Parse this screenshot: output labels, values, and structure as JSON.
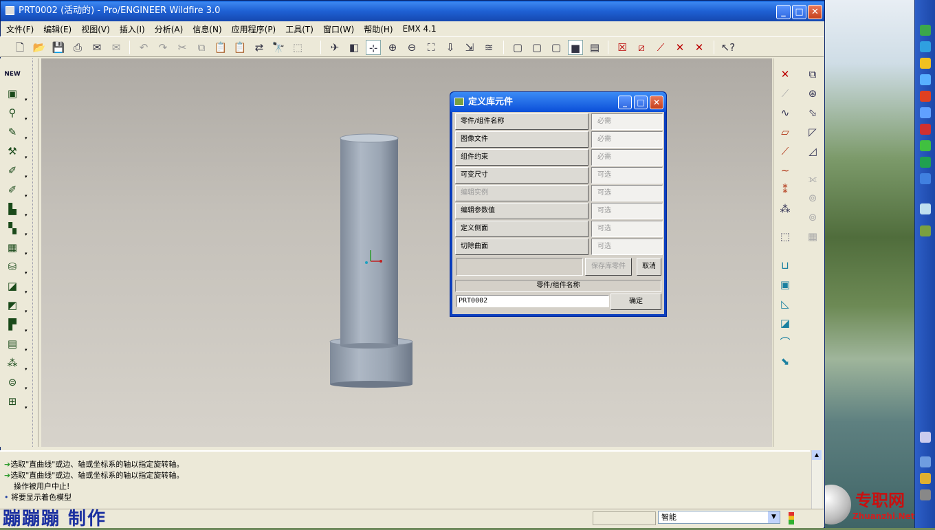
{
  "window": {
    "title": "PRT0002 (活动的) - Pro/ENGINEER Wildfire 3.0"
  },
  "menu": [
    "文件(F)",
    "编辑(E)",
    "视图(V)",
    "插入(I)",
    "分析(A)",
    "信息(N)",
    "应用程序(P)",
    "工具(T)",
    "窗口(W)",
    "帮助(H)",
    "EMX 4.1"
  ],
  "left_toolbar": {
    "new_label": "NEW"
  },
  "dialog": {
    "title": "定义库元件",
    "rows": [
      {
        "label": "零件/组件名称",
        "value": "必需",
        "enabled": true
      },
      {
        "label": "图像文件",
        "value": "必需",
        "enabled": true
      },
      {
        "label": "组件约束",
        "value": "必需",
        "enabled": true
      },
      {
        "label": "可变尺寸",
        "value": "可选",
        "enabled": true
      },
      {
        "label": "编辑实例",
        "value": "可选",
        "enabled": false
      },
      {
        "label": "编辑参数值",
        "value": "可选",
        "enabled": true
      },
      {
        "label": "定义侧面",
        "value": "可选",
        "enabled": true
      },
      {
        "label": "切除曲面",
        "value": "可选",
        "enabled": true
      }
    ],
    "save_label": "保存库零件",
    "cancel_label": "取消",
    "section_label": "零件/组件名称",
    "name_value": "PRT0002",
    "ok_label": "确定"
  },
  "messages": [
    "选取\"直曲线\"或边、轴或坐标系的轴以指定旋转轴。",
    "选取\"直曲线\"或边、轴或坐标系的轴以指定旋转轴。",
    "操作被用户中止!",
    "将要显示着色模型"
  ],
  "status": {
    "watermark": "蹦蹦蹦 制作",
    "mode": "智能"
  },
  "desktop": {
    "logo_cn": "专职网",
    "logo_en": "Zhuanzhi.Net"
  }
}
